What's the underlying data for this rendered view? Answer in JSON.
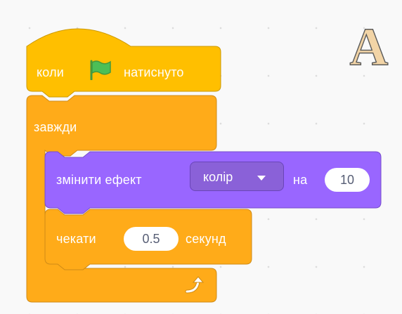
{
  "hat_block": {
    "prefix": "коли",
    "suffix": "натиснуто",
    "icon": "green-flag-icon"
  },
  "forever_block": {
    "label": "завжди",
    "icon": "loop-arrow-icon"
  },
  "effect_block": {
    "label": "змінити ефект",
    "effect_value": "колір",
    "by_label": "на",
    "amount": "10"
  },
  "wait_block": {
    "label": "чекати",
    "duration": "0.5",
    "unit_label": "секунд"
  },
  "sprite": {
    "letter": "A"
  },
  "colors": {
    "events": "#ffbf00",
    "control": "#ffab19",
    "looks": "#9966ff",
    "flag": "#4cbf56"
  }
}
